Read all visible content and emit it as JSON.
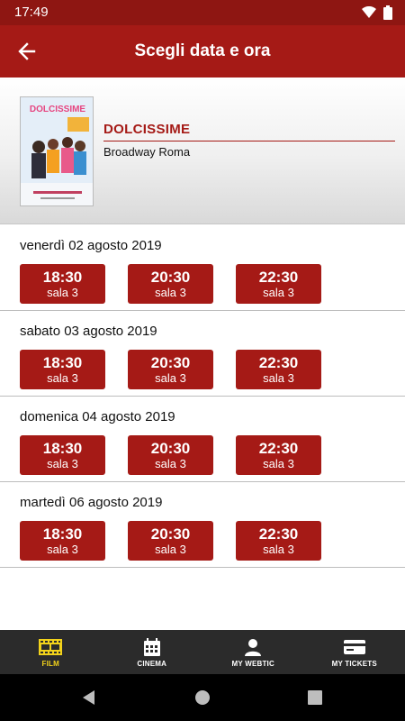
{
  "status_bar": {
    "time": "17:49"
  },
  "app_bar": {
    "title": "Scegli data e ora",
    "back_icon": "arrow-left-icon"
  },
  "movie": {
    "title": "DOLCISSIME",
    "cinema": "Broadway Roma",
    "poster": {
      "title_text": "DOLCISSIME"
    }
  },
  "days": [
    {
      "date": "venerdì 02 agosto 2019",
      "slots": [
        {
          "time": "18:30",
          "room": "sala 3"
        },
        {
          "time": "20:30",
          "room": "sala 3"
        },
        {
          "time": "22:30",
          "room": "sala 3"
        }
      ]
    },
    {
      "date": "sabato 03 agosto 2019",
      "slots": [
        {
          "time": "18:30",
          "room": "sala 3"
        },
        {
          "time": "20:30",
          "room": "sala 3"
        },
        {
          "time": "22:30",
          "room": "sala 3"
        }
      ]
    },
    {
      "date": "domenica 04 agosto 2019",
      "slots": [
        {
          "time": "18:30",
          "room": "sala 3"
        },
        {
          "time": "20:30",
          "room": "sala 3"
        },
        {
          "time": "22:30",
          "room": "sala 3"
        }
      ]
    },
    {
      "date": "martedì 06 agosto 2019",
      "slots": [
        {
          "time": "18:30",
          "room": "sala 3"
        },
        {
          "time": "20:30",
          "room": "sala 3"
        },
        {
          "time": "22:30",
          "room": "sala 3"
        }
      ]
    }
  ],
  "bottom_nav": [
    {
      "label": "FILM",
      "icon": "film-strip-icon",
      "active": true
    },
    {
      "label": "CINEMA",
      "icon": "calendar-icon",
      "active": false
    },
    {
      "label": "MY WEBTIC",
      "icon": "user-icon",
      "active": false
    },
    {
      "label": "MY TICKETS",
      "icon": "ticket-card-icon",
      "active": false
    }
  ],
  "colors": {
    "primary": "#a51a16",
    "status_bar": "#8e1612",
    "nav_bg": "#2b2b2b",
    "nav_active": "#f2d21b"
  }
}
